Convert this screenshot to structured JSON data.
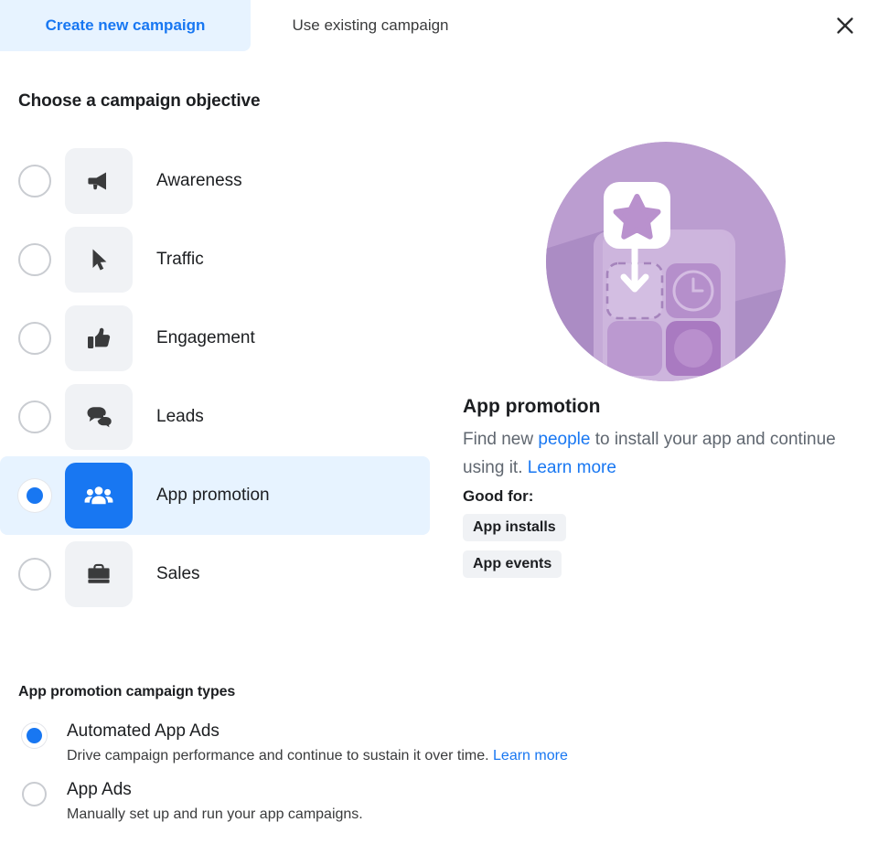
{
  "tabs": [
    {
      "label": "Create new campaign",
      "active": true
    },
    {
      "label": "Use existing campaign",
      "active": false
    }
  ],
  "close_label": "close-icon",
  "objective_section": {
    "heading": "Choose a campaign objective",
    "items": [
      {
        "label": "Awareness",
        "icon": "megaphone-icon",
        "selected": false
      },
      {
        "label": "Traffic",
        "icon": "cursor-icon",
        "selected": false
      },
      {
        "label": "Engagement",
        "icon": "thumbs-up-icon",
        "selected": false
      },
      {
        "label": "Leads",
        "icon": "chat-bubbles-icon",
        "selected": false
      },
      {
        "label": "App promotion",
        "icon": "people-group-icon",
        "selected": true
      },
      {
        "label": "Sales",
        "icon": "briefcase-icon",
        "selected": false
      }
    ]
  },
  "detail": {
    "illustration": "app-promotion-illustration",
    "title": "App promotion",
    "desc_part1": "Find new ",
    "desc_link1": "people",
    "desc_part2": " to install your app and continue using it. ",
    "desc_link2": "Learn more",
    "good_for_label": "Good for:",
    "tags": [
      "App installs",
      "App events"
    ]
  },
  "types_section": {
    "heading": "App promotion campaign types",
    "items": [
      {
        "title": "Automated App Ads",
        "desc": "Drive campaign performance and continue to sustain it over time. ",
        "link": "Learn more",
        "selected": true
      },
      {
        "title": "App Ads",
        "desc": "Manually set up and run your app campaigns.",
        "link": "",
        "selected": false
      }
    ]
  },
  "colors": {
    "accent": "#1877f2",
    "accent_bg": "#e7f3ff",
    "tile_bg": "#f0f2f5",
    "text": "#1c1e21",
    "muted": "#606770",
    "illustration_circle": "#b79ccc"
  }
}
